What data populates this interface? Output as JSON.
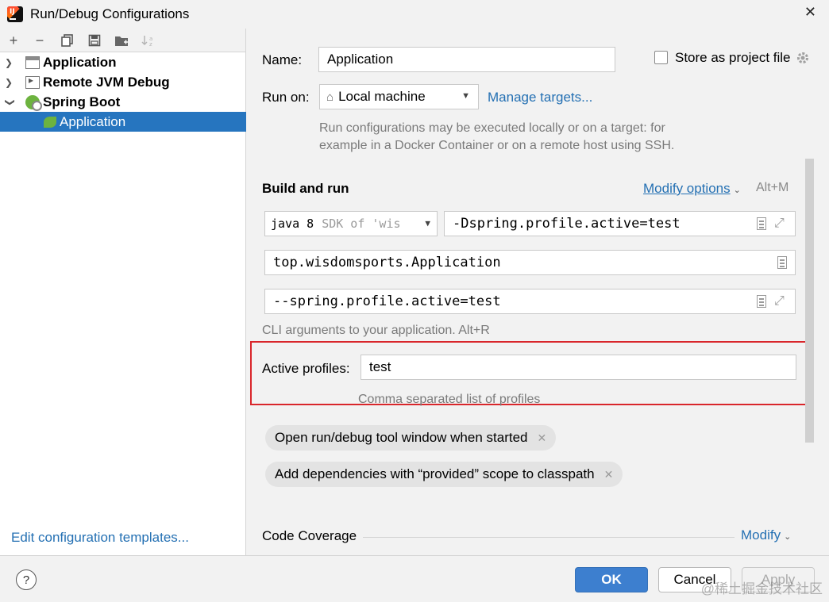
{
  "window": {
    "title": "Run/Debug Configurations",
    "close_icon": "close-icon"
  },
  "toolbar": {
    "buttons": [
      {
        "name": "add-icon",
        "glyph": "+"
      },
      {
        "name": "remove-icon",
        "glyph": "−"
      },
      {
        "name": "copy-icon",
        "glyph": "⧉"
      },
      {
        "name": "save-icon",
        "glyph": "▣"
      },
      {
        "name": "folder-icon",
        "glyph": "▰"
      },
      {
        "name": "sort-icon",
        "glyph": "↓"
      }
    ]
  },
  "tree": {
    "items": [
      {
        "label": "Application",
        "icon": "application-config-icon",
        "expanded": false
      },
      {
        "label": "Remote JVM Debug",
        "icon": "remote-debug-icon",
        "expanded": false
      },
      {
        "label": "Spring Boot",
        "icon": "spring-boot-icon",
        "expanded": true
      },
      {
        "label": "Application",
        "icon": "spring-app-icon",
        "selected": true
      }
    ],
    "edit_templates": "Edit configuration templates..."
  },
  "form": {
    "name_label": "Name:",
    "name_value": "Application",
    "store_as_project_file": "Store as project file",
    "store_checked": false,
    "run_on_label": "Run on:",
    "run_on_value": "Local machine",
    "manage_targets": "Manage targets...",
    "run_on_hint_1": "Run configurations may be executed locally or on a target: for",
    "run_on_hint_2": "example in a Docker Container or on a remote host using SSH.",
    "build_and_run": "Build and run",
    "modify_options": "Modify options",
    "modify_shortcut": "Alt+M",
    "jdk_value": "java 8",
    "jdk_suffix": "SDK of 'wis",
    "vm_options": "-Dspring.profile.active=test",
    "main_class": "top.wisdomsports.Application",
    "program_args": "--spring.profile.active=test",
    "cli_hint": "CLI arguments to your application. Alt+R",
    "active_profiles_label": "Active profiles:",
    "active_profiles_value": "test",
    "active_profiles_hint": "Comma separated list of profiles",
    "chips": [
      "Open run/debug tool window when started",
      "Add dependencies with “provided” scope to classpath"
    ],
    "code_coverage": "Code Coverage",
    "modify": "Modify"
  },
  "buttons": {
    "ok": "OK",
    "cancel": "Cancel",
    "apply": "Apply",
    "help": "?"
  },
  "watermark": "@稀土掘金技术社区",
  "colors": {
    "accent": "#2470b3",
    "selection": "#2675bf",
    "ok_button": "#3d7fcf",
    "highlight_box": "#d9262b"
  }
}
